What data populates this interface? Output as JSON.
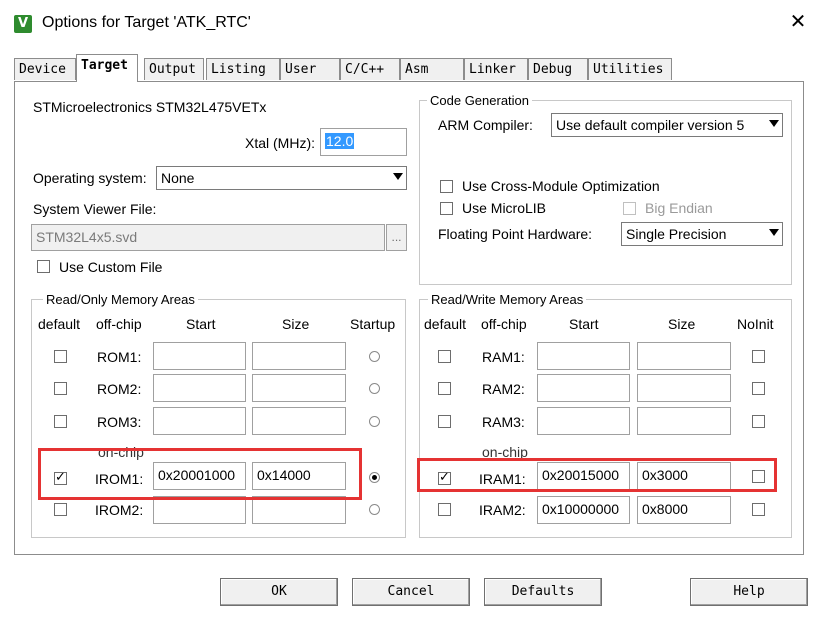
{
  "window": {
    "title": "Options for Target 'ATK_RTC'",
    "close_symbol": "✕"
  },
  "tabs": [
    "Device",
    "Target",
    "Output",
    "Listing",
    "User",
    "C/C++",
    "Asm",
    "Linker",
    "Debug",
    "Utilities"
  ],
  "active_tab": "Target",
  "target": {
    "device_name": "STMicroelectronics STM32L475VETx",
    "xtal_label": "Xtal (MHz):",
    "xtal_value": "12.0",
    "os_label": "Operating system:",
    "os_value": "None",
    "svd_label": "System Viewer File:",
    "svd_value": "STM32L4x5.svd",
    "browse_label": "...",
    "custom_file_label": "Use Custom File"
  },
  "code_gen": {
    "group_label": "Code Generation",
    "compiler_label": "ARM Compiler:",
    "compiler_value": "Use default compiler version 5",
    "cross_module_label": "Use Cross-Module Optimization",
    "microlib_label": "Use MicroLIB",
    "big_endian_label": "Big Endian",
    "fpu_label": "Floating Point Hardware:",
    "fpu_value": "Single Precision"
  },
  "ro_memory": {
    "group_label": "Read/Only Memory Areas",
    "headers": {
      "default": "default",
      "offchip": "off-chip",
      "start": "Start",
      "size": "Size",
      "startup": "Startup"
    },
    "onchip_label": "on-chip",
    "rows": [
      {
        "name": "ROM1:",
        "start": "",
        "size": "",
        "checked": false,
        "startup": false
      },
      {
        "name": "ROM2:",
        "start": "",
        "size": "",
        "checked": false,
        "startup": false
      },
      {
        "name": "ROM3:",
        "start": "",
        "size": "",
        "checked": false,
        "startup": false
      },
      {
        "name": "IROM1:",
        "start": "0x20001000",
        "size": "0x14000",
        "checked": true,
        "startup": true
      },
      {
        "name": "IROM2:",
        "start": "",
        "size": "",
        "checked": false,
        "startup": false
      }
    ]
  },
  "rw_memory": {
    "group_label": "Read/Write Memory Areas",
    "headers": {
      "default": "default",
      "offchip": "off-chip",
      "start": "Start",
      "size": "Size",
      "noinit": "NoInit"
    },
    "onchip_label": "on-chip",
    "rows": [
      {
        "name": "RAM1:",
        "start": "",
        "size": "",
        "checked": false
      },
      {
        "name": "RAM2:",
        "start": "",
        "size": "",
        "checked": false
      },
      {
        "name": "RAM3:",
        "start": "",
        "size": "",
        "checked": false
      },
      {
        "name": "IRAM1:",
        "start": "0x20015000",
        "size": "0x3000",
        "checked": true
      },
      {
        "name": "IRAM2:",
        "start": "0x10000000",
        "size": "0x8000",
        "checked": false
      }
    ]
  },
  "buttons": {
    "ok": "OK",
    "cancel": "Cancel",
    "defaults": "Defaults",
    "help": "Help"
  },
  "colors": {
    "highlight": "#e53333",
    "selection": "#3399ff"
  }
}
